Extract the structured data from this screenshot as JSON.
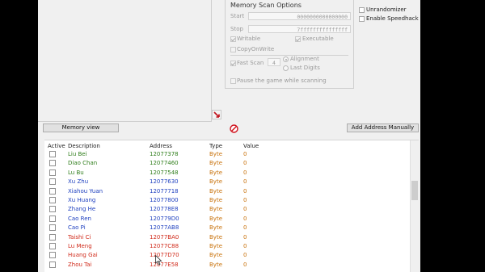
{
  "scan_options": {
    "title": "Memory Scan Options",
    "start_label": "Start",
    "start_value": "0000000000000000",
    "stop_label": "Stop",
    "stop_value": "7fffffffffffffff",
    "writable": "Writable",
    "executable": "Executable",
    "copyonwrite": "CopyOnWrite",
    "fast_scan": "Fast Scan",
    "fast_scan_value": "4",
    "alignment": "Alignment",
    "last_digits": "Last Digits",
    "pause_game": "Pause the game while scanning"
  },
  "right_options": {
    "unrandomizer": "Unrandomizer",
    "speedhack": "Enable Speedhack"
  },
  "toolbar": {
    "memory_view": "Memory view",
    "add_address": "Add Address Manually"
  },
  "table": {
    "headers": [
      "Active",
      "Description",
      "Address",
      "Type",
      "Value"
    ],
    "rows": [
      {
        "description": "Liu Bei",
        "address": "12077378",
        "type": "Byte",
        "value": "0",
        "color": "#2e7d1a"
      },
      {
        "description": "Diao Chan",
        "address": "12077460",
        "type": "Byte",
        "value": "0",
        "color": "#2e7d1a"
      },
      {
        "description": "Lu Bu",
        "address": "12077548",
        "type": "Byte",
        "value": "0",
        "color": "#2e7d1a"
      },
      {
        "description": "Xu Zhu",
        "address": "12077630",
        "type": "Byte",
        "value": "0",
        "color": "#1d3fbf"
      },
      {
        "description": "Xiahou Yuan",
        "address": "12077718",
        "type": "Byte",
        "value": "0",
        "color": "#1d3fbf"
      },
      {
        "description": "Xu Huang",
        "address": "12077800",
        "type": "Byte",
        "value": "0",
        "color": "#1d3fbf"
      },
      {
        "description": "Zhang He",
        "address": "120778E8",
        "type": "Byte",
        "value": "0",
        "color": "#1d3fbf"
      },
      {
        "description": "Cao Ren",
        "address": "120779D0",
        "type": "Byte",
        "value": "0",
        "color": "#1d3fbf"
      },
      {
        "description": "Cao Pi",
        "address": "12077AB8",
        "type": "Byte",
        "value": "0",
        "color": "#1d3fbf"
      },
      {
        "description": "Taishi Ci",
        "address": "12077BA0",
        "type": "Byte",
        "value": "0",
        "color": "#d02a1a"
      },
      {
        "description": "Lu Meng",
        "address": "12077C88",
        "type": "Byte",
        "value": "0",
        "color": "#d02a1a"
      },
      {
        "description": "Huang Gai",
        "address": "12077D70",
        "type": "Byte",
        "value": "0",
        "color": "#d02a1a"
      },
      {
        "description": "Zhou Tai",
        "address": "12077E58",
        "type": "Byte",
        "value": "0",
        "color": "#d02a1a"
      }
    ]
  },
  "colors": {
    "type_text": "#c8710a",
    "value_text": "#c8710a"
  },
  "icons": {
    "pointer": "red-arrow-pointer-icon",
    "stop": "stop-circle-icon",
    "cursor": "mouse-cursor-icon"
  }
}
